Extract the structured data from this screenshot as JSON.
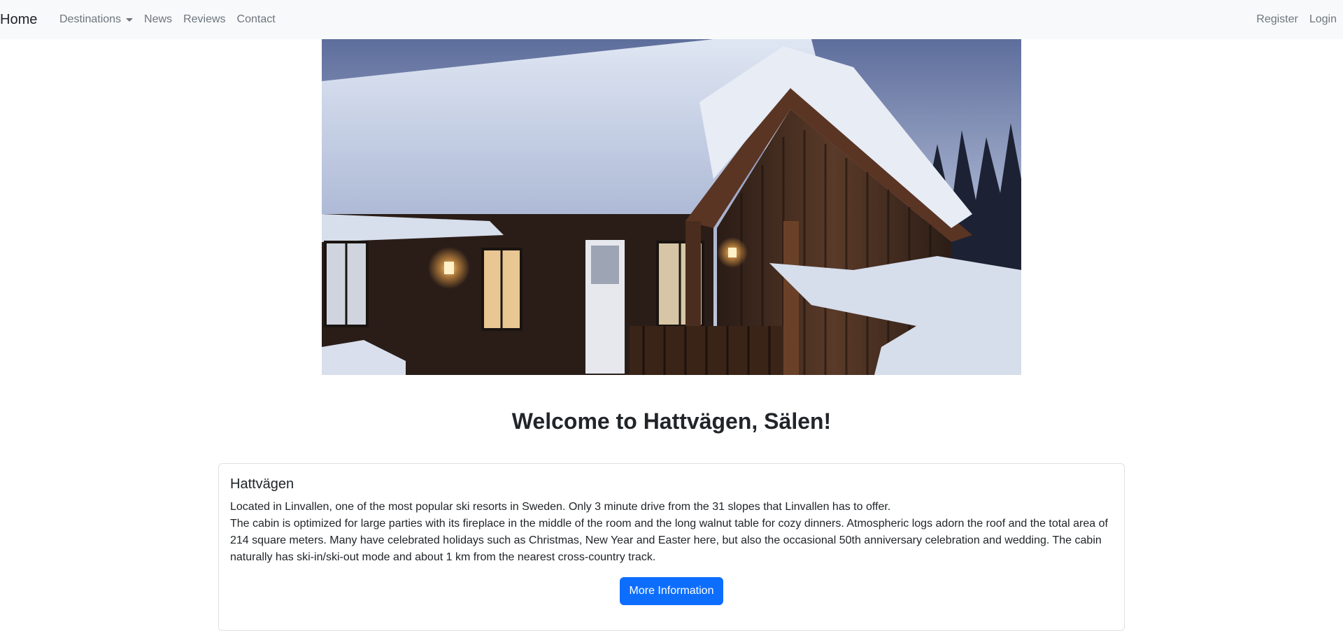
{
  "navbar": {
    "brand": "Home",
    "left_items": [
      {
        "label": "Destinations",
        "dropdown": true
      },
      {
        "label": "News"
      },
      {
        "label": "Reviews"
      },
      {
        "label": "Contact"
      }
    ],
    "right_items": [
      {
        "label": "Register"
      },
      {
        "label": "Login"
      }
    ]
  },
  "hero": {
    "image": "snowy-wooden-cabin-at-dusk"
  },
  "main": {
    "heading": "Welcome to Hattvägen, Sälen!"
  },
  "card": {
    "title": "Hattvägen",
    "line1": "Located in Linvallen, one of the most popular ski resorts in Sweden. Only 3 minute drive from the 31 slopes that Linvallen has to offer.",
    "line2": "The cabin is optimized for large parties with its fireplace in the middle of the room and the long walnut table for cozy dinners. Atmospheric logs adorn the roof and the total area of 214 square meters. Many have celebrated holidays such as Christmas, New Year and Easter here, but also the occasional 50th anniversary celebration and wedding. The cabin naturally has ski-in/ski-out mode and about 1 km from the nearest cross-country track.",
    "button_label": "More Information"
  },
  "colors": {
    "navbar_bg": "#f8f9fa",
    "link": "#6c757d",
    "primary": "#0d6efd"
  }
}
